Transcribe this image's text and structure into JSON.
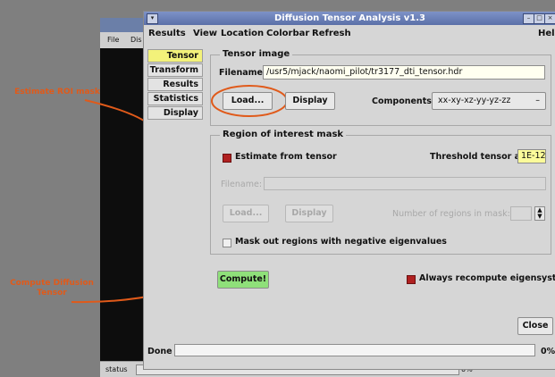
{
  "bg_app": {
    "menu": [
      "File",
      "Dis"
    ],
    "status_left": "status",
    "status_right": "0%"
  },
  "window": {
    "title": "Diffusion Tensor Analysis v1.3",
    "controls": [
      "minimize",
      "maximize",
      "close"
    ]
  },
  "menubar": [
    "Results",
    "View",
    "Location",
    "Colorbar",
    "Refresh",
    "Help"
  ],
  "sidebar": {
    "tabs": [
      {
        "label": "Tensor",
        "active": true
      },
      {
        "label": "Transform",
        "active": false
      },
      {
        "label": "Results",
        "active": false
      },
      {
        "label": "Statistics",
        "active": false
      },
      {
        "label": "Display",
        "active": false
      }
    ]
  },
  "tensor_image": {
    "title": "Tensor image",
    "filename_label": "Filename:",
    "filename_value": "/usr5/mjack/naomi_pilot/tr3177_dti_tensor.hdr",
    "load_label": "Load...",
    "display_label": "Display",
    "components_label": "Components:",
    "components_value": "xx-xy-xz-yy-yz-zz"
  },
  "roi_mask": {
    "title": "Region of interest mask",
    "estimate_label": "Estimate from tensor",
    "estimate_checked": true,
    "threshold_label": "Threshold tensor at:",
    "threshold_value": "1E-12",
    "filename_label": "Filename:",
    "load_label": "Load...",
    "display_label": "Display",
    "regions_label": "Number of regions in mask:",
    "mask_neg_label": "Mask out regions with negative eigenvalues",
    "mask_neg_checked": false
  },
  "compute_label": "Compute!",
  "always_recompute_label": "Always recompute eigensystem",
  "always_recompute_checked": true,
  "close_label": "Close",
  "status": {
    "text": "Done",
    "progress_text": "0%"
  },
  "annotations": {
    "estimate": "Estimate ROI mask",
    "compute": "Compute Diffusion Tensor"
  },
  "colors": {
    "annotation": "#e05a1a",
    "active_tab": "#f3f27a",
    "compute_button": "#8fe07a",
    "checked": "#b02020"
  }
}
